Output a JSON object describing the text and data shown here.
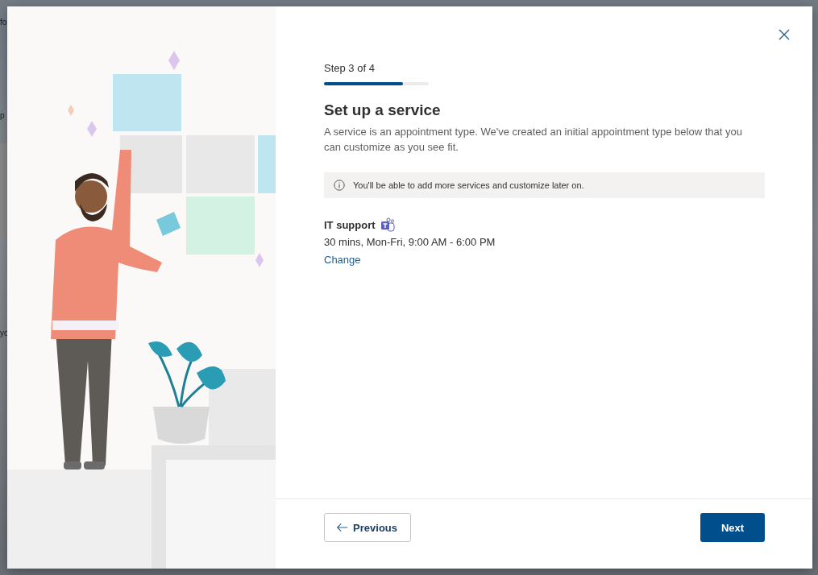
{
  "background_fragments": [
    "fo",
    "p",
    "yo"
  ],
  "dialog": {
    "step": "Step 3 of 4",
    "progress": {
      "level": 0.75
    },
    "title": "Set up a service",
    "description": "A service is an appointment type. We've created an initial appointment type below that you can customize as you see fit.",
    "info": "You'll be able to add more services and customize later on.",
    "service": {
      "name": "IT support",
      "details": "30 mins, Mon-Fri, 9:00 AM - 6:00 PM",
      "link": "Change"
    },
    "buttons": [
      {
        "kind": "secondary",
        "label": "Previous"
      },
      {
        "kind": "primary",
        "label": "Next"
      }
    ]
  }
}
